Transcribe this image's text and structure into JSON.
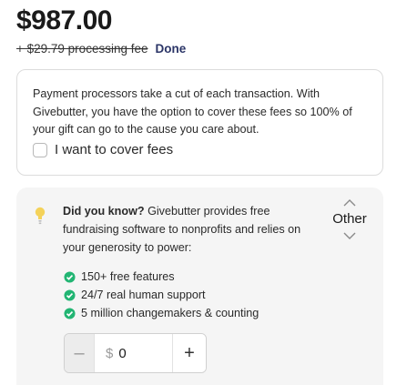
{
  "total": {
    "amount": "$987.00"
  },
  "fee": {
    "text": "+ $29.79 processing fee",
    "done_label": "Done"
  },
  "fees_card": {
    "description": "Payment processors take a cut of each transaction. With Givebutter, you have the option to cover these fees so 100% of your gift can go to the cause you care about.",
    "checkbox_label": "I want to cover fees"
  },
  "info": {
    "heading": "Did you know?",
    "body": "Givebutter provides free fundraising software to nonprofits and relies on your generosity to power:",
    "features": [
      "150+ free features",
      "24/7 real human support",
      "5 million changemakers & counting"
    ],
    "tip_selection": "Other",
    "custom_amount": {
      "currency": "$",
      "value": "0",
      "minus": "–",
      "plus": "+"
    }
  },
  "colors": {
    "check_green": "#22b573",
    "bulb_yellow": "#f4d25a",
    "link": "#2b3567"
  },
  "icons": [
    "lightbulb-icon",
    "check-circle-icon",
    "chevron-up-icon",
    "chevron-down-icon"
  ]
}
